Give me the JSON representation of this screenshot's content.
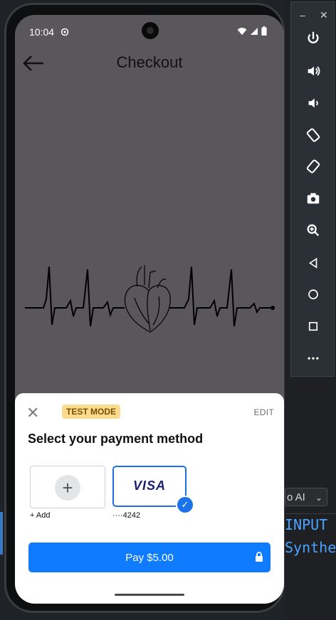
{
  "status_bar": {
    "time": "10:04"
  },
  "topbar": {
    "title": "Checkout"
  },
  "payment_sheet": {
    "badge": "TEST MODE",
    "edit_label": "EDIT",
    "title": "Select your payment method",
    "add_label": "+ Add",
    "card_brand": "VISA",
    "card_last4": "····4242",
    "pay_button": "Pay $5.00"
  },
  "ide": {
    "dropdown": "o AI",
    "line1": "INPUT",
    "line2": "Synthe"
  },
  "colors": {
    "accent": "#0f7bff",
    "badge_bg": "#fbdc8e",
    "screen_bg": "#5a575b"
  },
  "icons": {
    "side_panel": [
      "power-icon",
      "volume-up-icon",
      "volume-down-icon",
      "rotate-left-icon",
      "rotate-right-icon",
      "camera-icon",
      "zoom-icon",
      "back-icon",
      "home-icon",
      "overview-icon",
      "more-icon"
    ]
  }
}
